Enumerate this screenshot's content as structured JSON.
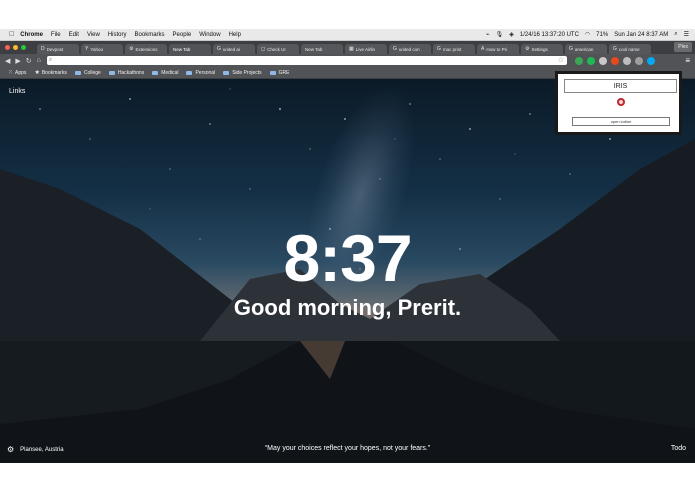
{
  "menubar": {
    "apple_icon": "apple-icon",
    "app": "Chrome",
    "items": [
      "File",
      "Edit",
      "View",
      "History",
      "Bookmarks",
      "People",
      "Window",
      "Help"
    ],
    "status_datetime": "1/24/16 13:37:20 UTC",
    "battery": "71%",
    "clock": "Sun Jan 24  8:37 AM"
  },
  "tabs": [
    {
      "label": "Devpost",
      "icon": "D",
      "active": false
    },
    {
      "label": "Yahoo",
      "icon": "Y",
      "active": false
    },
    {
      "label": "Extensions",
      "icon": "⚙",
      "active": false
    },
    {
      "label": "New Tab",
      "icon": "",
      "active": true
    },
    {
      "label": "united ai",
      "icon": "G",
      "active": false
    },
    {
      "label": "Check Ur",
      "icon": "◻",
      "active": false
    },
    {
      "label": "New Tab",
      "icon": "",
      "active": false
    },
    {
      "label": "Live Airlin",
      "icon": "▦",
      "active": false
    },
    {
      "label": "united con",
      "icon": "G",
      "active": false
    },
    {
      "label": "mac print",
      "icon": "G",
      "active": false
    },
    {
      "label": "How to Pri",
      "icon": "A",
      "active": false
    },
    {
      "label": "Settings",
      "icon": "⚙",
      "active": false
    },
    {
      "label": "american",
      "icon": "G",
      "active": false
    },
    {
      "label": "cool name",
      "icon": "G",
      "active": false
    }
  ],
  "guest_label": "Plex",
  "omnibox": {
    "value": "",
    "placeholder": ""
  },
  "bookmarks": {
    "apps": "Apps",
    "items": [
      "Bookmarks",
      "College",
      "Hackathons",
      "Medical",
      "Personal",
      "Side Projects",
      "GRE"
    ]
  },
  "momentum": {
    "links": "Links",
    "time": "8:37",
    "greeting": "Good morning, Prerit.",
    "location": "Plansee, Austria",
    "quote": "“May your choices reflect your hopes, not your fears.”",
    "todo": "Todo"
  },
  "iris_popup": {
    "title": "IRIS",
    "button": "open iodine",
    "record_color": "#c0282c"
  },
  "colors": {
    "traffic_red": "#fc5f57",
    "traffic_yellow": "#fdbc2e",
    "traffic_green": "#28c840",
    "extension_icons": [
      "#3aa757",
      "#1db954",
      "#c8c8c8",
      "#e64a19",
      "#bdbdbd",
      "#9e9e9e",
      "#03a9f4"
    ]
  }
}
